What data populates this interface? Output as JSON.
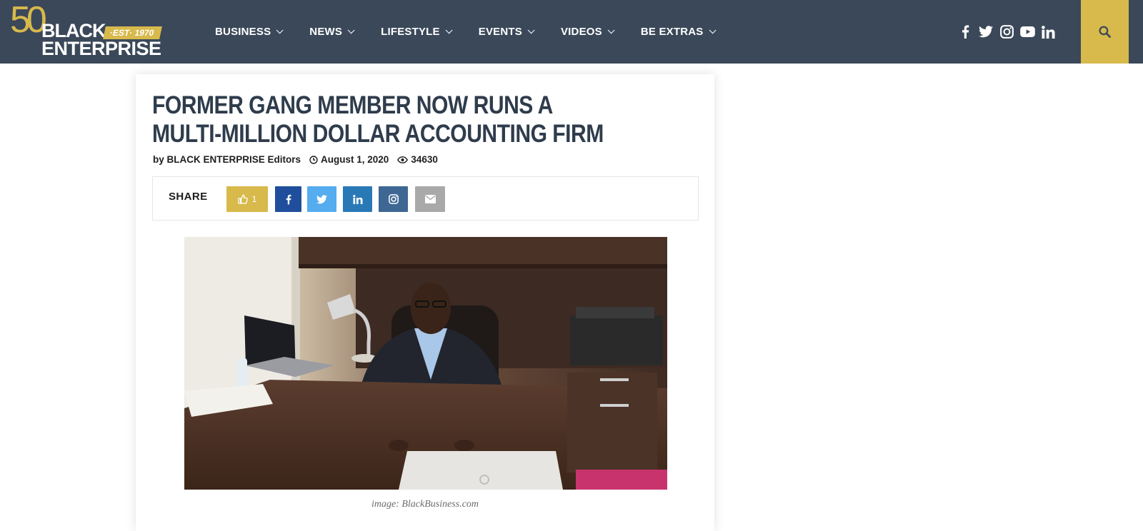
{
  "brand": {
    "fifty": "50",
    "name_top": "BLACK",
    "name_bottom": "ENTERPRISE",
    "est": "·EST· 1970",
    "colors": {
      "header_bg": "#3b4859",
      "gold": "#d7b94c"
    }
  },
  "nav": {
    "items": [
      {
        "label": "BUSINESS"
      },
      {
        "label": "NEWS"
      },
      {
        "label": "LIFESTYLE"
      },
      {
        "label": "EVENTS"
      },
      {
        "label": "VIDEOS"
      },
      {
        "label": "BE EXTRAS"
      }
    ]
  },
  "social_icons": [
    "facebook-icon",
    "twitter-icon",
    "instagram-icon",
    "youtube-icon",
    "linkedin-icon"
  ],
  "search": {
    "icon": "search-icon"
  },
  "article": {
    "title": "FORMER GANG MEMBER NOW RUNS A MULTI-MILLION DOLLAR ACCOUNTING FIRM",
    "byline": "by BLACK ENTERPRISE Editors",
    "date": "August 1, 2020",
    "views": "34630",
    "share_label": "SHARE",
    "like_count": "1",
    "share_buttons": {
      "facebook_color": "#1f4e9c",
      "twitter_color": "#55acee",
      "linkedin_color": "#2a79b7",
      "instagram_color": "#3f6794",
      "email_color": "#a9a9a9"
    },
    "image_caption": "image: BlackBusiness.com"
  }
}
